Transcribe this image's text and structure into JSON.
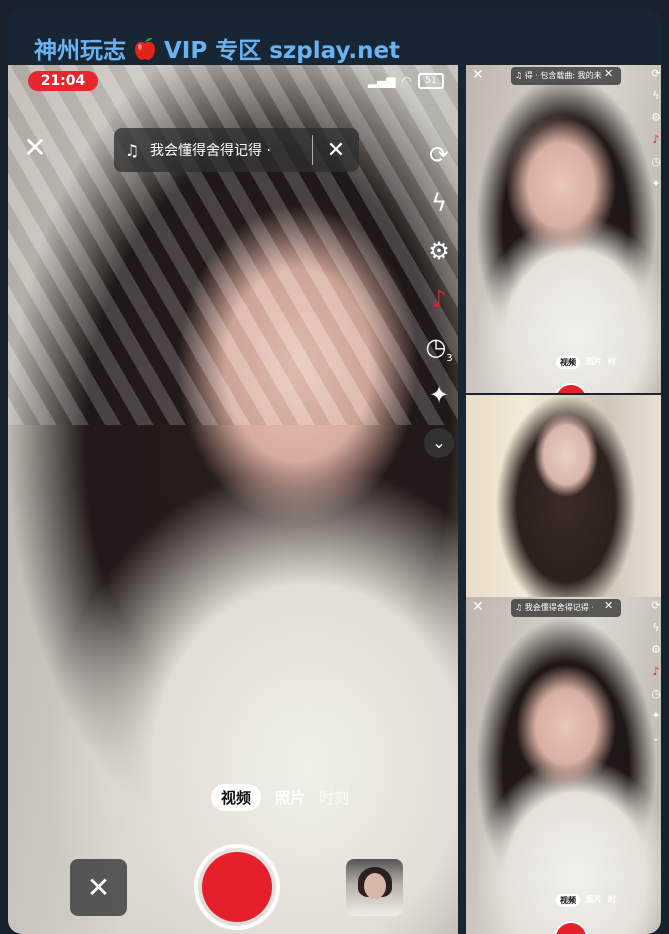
{
  "header": {
    "text_before": "神州玩志",
    "text_after": "VIP 专区 szplay.net",
    "icon": "apple-icon"
  },
  "main_photo": {
    "status_time": "21:04",
    "battery": "51",
    "music_text": "我会懂得舍得记得 ·",
    "icons": [
      "close-icon",
      "music-note-icon",
      "flip-camera-icon",
      "flash-off-icon",
      "settings-icon",
      "mic-off-icon",
      "timer-icon",
      "beauty-wand-icon",
      "chevron-down-icon"
    ],
    "timer_badge": "3",
    "tabs": [
      "视频",
      "照片",
      "时刻"
    ],
    "active_tab": "视频"
  },
  "thumb1": {
    "music_text": "得 · 包含载曲: 我的未",
    "tabs": [
      "视频",
      "照片",
      "时"
    ]
  },
  "thumb3": {
    "music_text": "我会懂得舍得记得 ·",
    "tabs": [
      "视频",
      "照片",
      "时"
    ]
  },
  "colors": {
    "background": "#17212b",
    "accent": "#6ab3f3",
    "record_red": "#e5202b"
  }
}
